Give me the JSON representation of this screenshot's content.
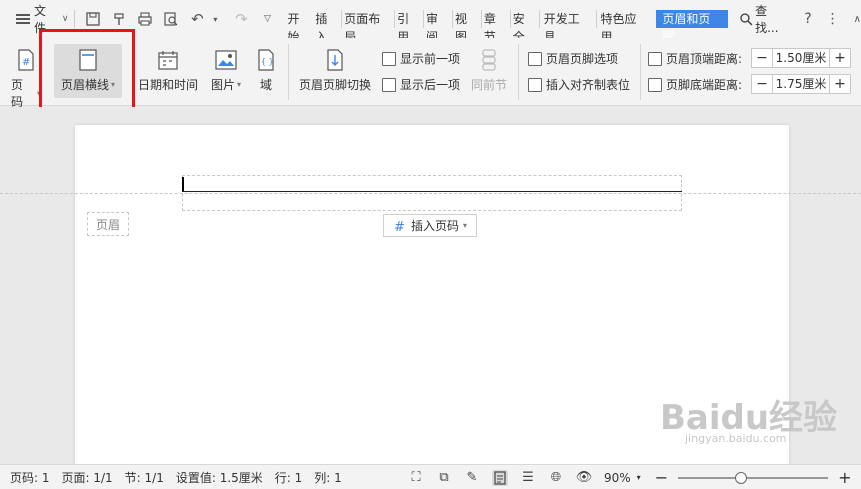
{
  "menubar": {
    "file_label": "文件",
    "tabs": [
      "开始",
      "插入",
      "页面布局",
      "引用",
      "审阅",
      "视图",
      "章节",
      "安全",
      "开发工具",
      "特色应用"
    ],
    "active_tab": "页眉和页脚",
    "search_label": "查找...",
    "accent": "#3c86e6"
  },
  "ribbon": {
    "page_num": "页码",
    "header_line": "页眉横线",
    "date_time": "日期和时间",
    "picture": "图片",
    "field": "域",
    "switch": "页眉页脚切换",
    "show_prev": "显示前一项",
    "show_next": "显示后一项",
    "same_prev": "同前节",
    "options": "页眉页脚选项",
    "align_tab": "插入对齐制表位",
    "top_dist_label": "页眉顶端距离:",
    "top_dist_value": "1.50厘米",
    "bottom_dist_label": "页脚底端距离:",
    "bottom_dist_value": "1.75厘米",
    "highlight_color": "#e6141e"
  },
  "document": {
    "header_label": "页眉",
    "insert_page_num": "插入页码"
  },
  "status": {
    "page_num": "页码: 1",
    "pages": "页面: 1/1",
    "section": "节: 1/1",
    "setting": "设置值: 1.5厘米",
    "row": "行: 1",
    "col": "列: 1",
    "zoom": "90%",
    "zoom_level": 0.9
  },
  "watermark": {
    "brand": "Baidu经验",
    "url": "jingyan.baidu.com"
  }
}
